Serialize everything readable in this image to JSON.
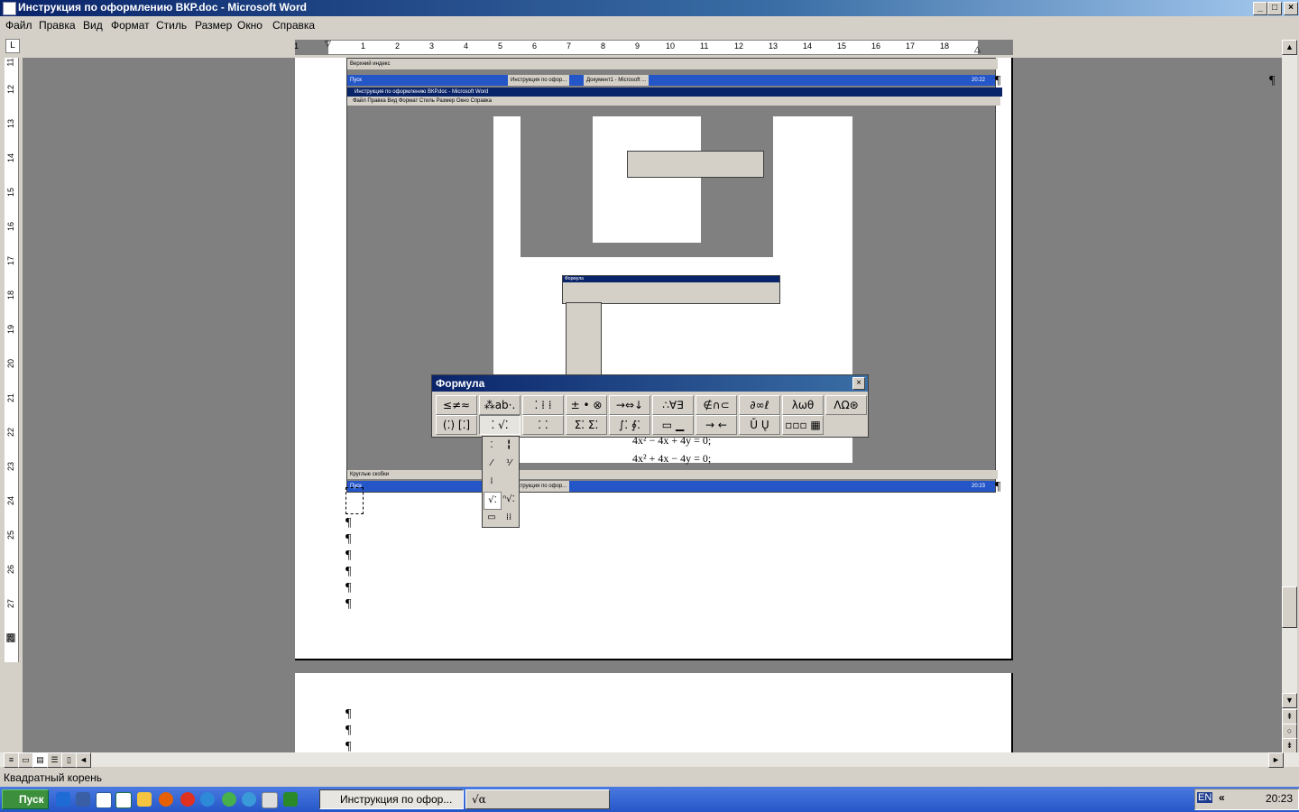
{
  "window": {
    "title": "Инструкция по оформлению ВКР.doc - Microsoft Word",
    "buttons": {
      "minimize": "_",
      "maximize": "□",
      "close": "×"
    }
  },
  "menu": [
    "Файл",
    "Правка",
    "Вид",
    "Формат",
    "Стиль",
    "Размер",
    "Окно",
    "Справка"
  ],
  "ruler": {
    "h_numbers": [
      "1",
      "1",
      "2",
      "3",
      "4",
      "5",
      "6",
      "7",
      "8",
      "9",
      "10",
      "11",
      "12",
      "13",
      "14",
      "15",
      "16",
      "17",
      "18"
    ],
    "v_numbers": [
      "11",
      "12",
      "13",
      "14",
      "15",
      "16",
      "17",
      "18",
      "19",
      "20",
      "21",
      "22",
      "23",
      "24",
      "25",
      "26",
      "27",
      "28"
    ]
  },
  "document": {
    "pilcrow": "¶",
    "embedded_caption_top": "Верхний индекс",
    "embedded_caption_bottom": "Круглые скобки",
    "equation1": "4x² − 4x + 4y = 0;",
    "equation2": "4x² + 4x − 4y = 0;"
  },
  "embedded": {
    "window_title": "Инструкция по оформлению ВКР.doc - Microsoft Word",
    "menu": "Файл  Правка  Вид  Формат  Стиль  Размер  Окно  Справка",
    "start": "Пуск",
    "task1": "Инструкция по офор...",
    "task2": "Документ1 - Microsoft ...",
    "time1": "20:22",
    "time2": "20:23",
    "mini_formula_title": "Формула"
  },
  "formula_toolbar": {
    "title": "Формула",
    "close": "×",
    "row1": [
      "≤≠≈",
      "⁂ab·.",
      "⁚ ⁞ ⁞",
      "± • ⊗",
      "→⇔↓",
      "∴∀∃",
      "∉∩⊂",
      "∂∞ℓ",
      "λωθ",
      "ΛΩ⊛"
    ],
    "row2": [
      "(⁚) [⁚]",
      "⁚ √⁚",
      "⁚ ⁚",
      "Σ⁚ Σ⁚",
      "∫⁚ ∮⁚",
      "▭ ▁",
      "→ ←",
      "Ū Ų",
      "▫▫▫ ▦"
    ]
  },
  "palette": [
    "⁚",
    "╏",
    "⁄",
    "⅟",
    "⁞",
    "",
    "√⁚",
    "ⁿ√⁚",
    "▭",
    "⁞⁞"
  ],
  "status": {
    "text": "Квадратный корень"
  },
  "taskbar": {
    "start": "Пуск",
    "task_word": "Инструкция по офор...",
    "task_eq": "√α",
    "lang": "EN",
    "arrows": "«",
    "time": "20:23"
  },
  "colors": {
    "title_start": "#0a246a",
    "title_end": "#a6caf0",
    "taskbar": "#2556c8",
    "doc_bg": "#808080"
  }
}
